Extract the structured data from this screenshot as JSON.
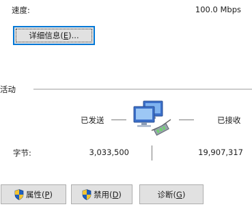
{
  "speed": {
    "label": "速度:",
    "value": "100.0 Mbps"
  },
  "details_button": {
    "label_prefix": "详细信息(",
    "label_key": "E",
    "label_suffix": ")..."
  },
  "activity": {
    "group_label": "活动",
    "sent_label": "已发送",
    "received_label": "已接收",
    "bytes_label": "字节:",
    "bytes_sent": "3,033,500",
    "bytes_received": "19,907,317"
  },
  "buttons": {
    "properties": {
      "prefix": "属性(",
      "key": "P",
      "suffix": ")",
      "icon": "uac-shield-icon"
    },
    "disable": {
      "prefix": "禁用(",
      "key": "D",
      "suffix": ")",
      "icon": "uac-shield-icon"
    },
    "diagnose": {
      "prefix": "诊断(",
      "key": "G",
      "suffix": ")"
    }
  },
  "colors": {
    "focus_border": "#0078d7",
    "button_face": "#e1e1e1",
    "shield_blue": "#1f5fbf",
    "shield_yellow": "#f4c430"
  }
}
